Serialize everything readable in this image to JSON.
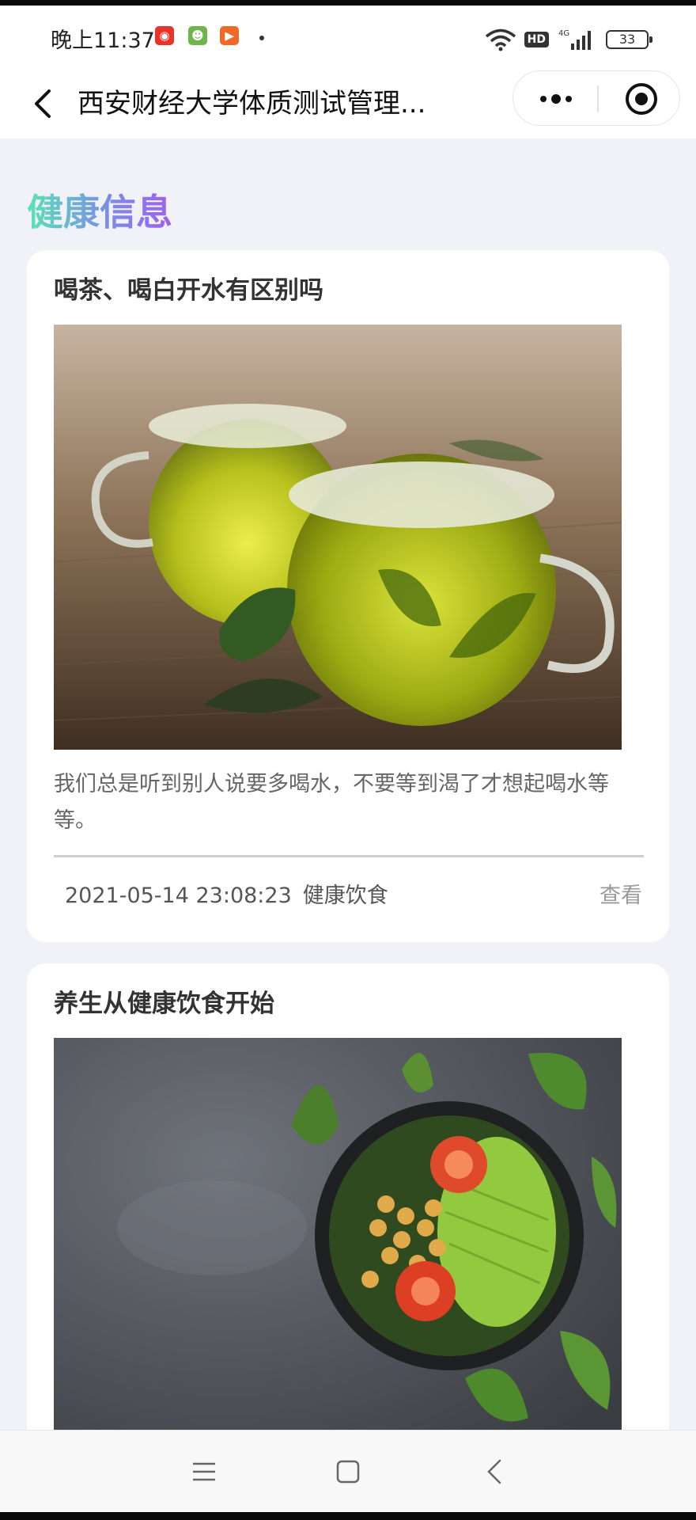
{
  "status_bar": {
    "time": "晚上11:37",
    "app_icons": [
      {
        "name": "netease-music-icon",
        "color": "#e8322a",
        "glyph": "◉"
      },
      {
        "name": "android-app-icon",
        "color": "#6fb64a",
        "glyph": "☻"
      },
      {
        "name": "video-app-icon",
        "color": "#f06a27",
        "glyph": "▶"
      }
    ],
    "network_label": "4G",
    "hd_label": "HD",
    "battery": "33"
  },
  "nav": {
    "title": "西安财经大学体质测试管理..."
  },
  "section": {
    "title": "健康信息"
  },
  "articles": [
    {
      "title": "喝茶、喝白开水有区别吗",
      "description": "我们总是听到别人说要多喝水，不要等到渴了才想起喝水等等。",
      "datetime": "2021-05-14 23:08:23",
      "category": "健康饮食",
      "view_label": "查看",
      "image": "green-tea-cups-image"
    },
    {
      "title": "养生从健康饮食开始",
      "image": "healthy-salad-bowl-image"
    }
  ],
  "colors": {
    "page_bg": "#f1f2f7",
    "card_bg": "#ffffff",
    "title_gradient_start": "#5be3b5",
    "title_gradient_end": "#9f5ff0"
  }
}
